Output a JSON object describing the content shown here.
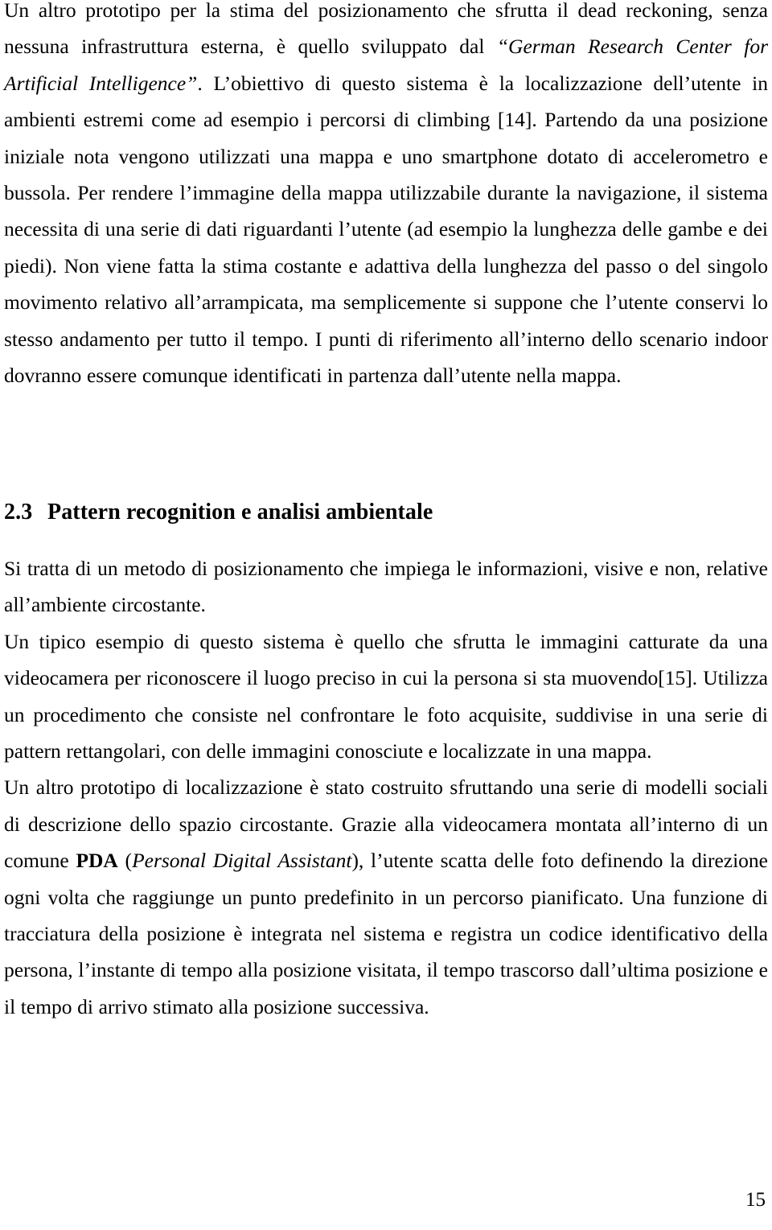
{
  "document": {
    "language": "it",
    "page_number": "15",
    "text_color": "#000000",
    "background_color": "#ffffff"
  },
  "intro_paragraph": {
    "run_1": "Un altro prototipo per la stima del posizionamento che sfrutta il dead reckoning, senza nessuna infrastruttura esterna, è quello sviluppato dal ",
    "run_2_italic": "“German Research Center for Artificial Intelligence”",
    "run_3": ". L’obiettivo di questo sistema è la localizzazione dell’utente in ambienti estremi come ad esempio i percorsi di climbing [14]. Partendo da una posizione iniziale nota vengono utilizzati una mappa e uno smartphone dotato di accelerometro e bussola. Per rendere l’immagine della mappa utilizzabile durante la navigazione, il sistema necessita di una serie di dati riguardanti l’utente (ad esempio la lunghezza delle gambe e dei piedi). Non viene fatta la stima costante e adattiva della lunghezza del passo o del singolo movimento relativo all’arrampicata, ma semplicemente si suppone che l’utente conservi lo stesso andamento per tutto il tempo. I punti di riferimento all’interno dello scenario indoor dovranno essere comunque identificati in partenza dall’utente nella mappa."
  },
  "section": {
    "number": "2.3",
    "title": "Pattern recognition e analisi ambientale"
  },
  "paragraphs": {
    "p1": "Si tratta di un metodo di posizionamento che impiega le informazioni, visive e non, relative all’ambiente circostante.",
    "p2": "Un tipico esempio di questo sistema è quello che sfrutta le immagini catturate da una videocamera per riconoscere il luogo preciso in cui la persona si sta muovendo[15]. Utilizza un procedimento che consiste nel confrontare le foto acquisite, suddivise in una serie di pattern rettangolari, con delle immagini conosciute e localizzate in una mappa.",
    "p3_run_1": "Un altro prototipo di localizzazione è stato costruito sfruttando una serie di modelli sociali di descrizione dello spazio circostante.  Grazie alla videocamera montata all’interno di un comune ",
    "p3_run_2_bold": "PDA",
    "p3_run_3": " (",
    "p3_run_4_italic": "Personal Digital Assistant",
    "p3_run_5": "), l’utente scatta delle foto definendo la direzione ogni volta che raggiunge un punto predefinito in un percorso pianificato.  Una funzione di tracciatura della posizione è integrata nel sistema e registra un codice identificativo della persona, l’instante di tempo alla posizione visitata, il tempo trascorso dall’ultima posizione e il tempo di arrivo stimato alla posizione successiva."
  }
}
